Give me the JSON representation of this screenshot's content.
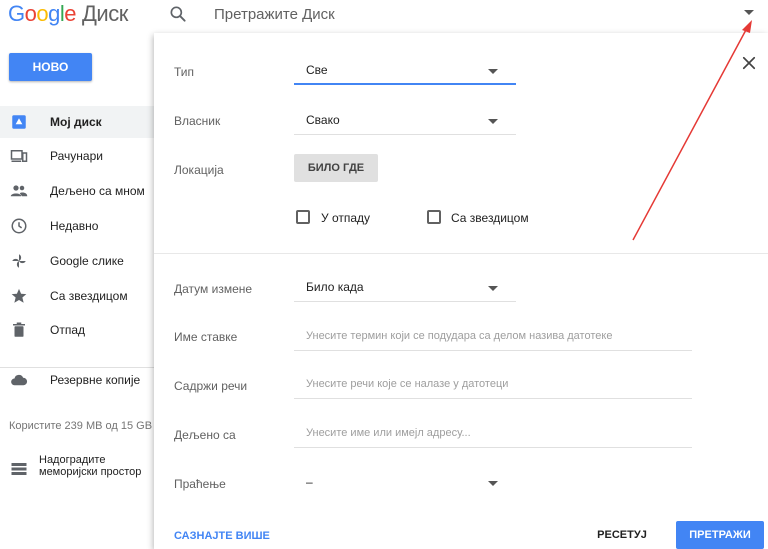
{
  "header": {
    "logo_letters": [
      "G",
      "o",
      "o",
      "g",
      "l",
      "e"
    ],
    "product": "Диск",
    "search_placeholder": "Претражите Диск"
  },
  "sidebar": {
    "new_label": "НОВО",
    "items": [
      {
        "label": "Мој диск",
        "icon": "my-drive-icon",
        "active": true
      },
      {
        "label": "Рачунари",
        "icon": "computers-icon"
      },
      {
        "label": "Дељено са мном",
        "icon": "shared-people-icon"
      },
      {
        "label": "Недавно",
        "icon": "clock-icon"
      },
      {
        "label": "Google слике",
        "icon": "pinwheel-icon"
      },
      {
        "label": "Са звездицом",
        "icon": "star-icon"
      },
      {
        "label": "Отпад",
        "icon": "trash-icon"
      },
      {
        "label": "Резервне копије",
        "icon": "cloud-icon"
      }
    ],
    "storage": "Користите 239 MB од 15 GB",
    "upgrade": "Надоградите меморијски простор"
  },
  "panel": {
    "type_label": "Тип",
    "type_value": "Све",
    "owner_label": "Власник",
    "owner_value": "Свако",
    "location_label": "Локација",
    "location_button": "БИЛО ГДЕ",
    "trash_checkbox": "У отпаду",
    "starred_checkbox": "Са звездицом",
    "modified_label": "Датум измене",
    "modified_value": "Било када",
    "item_name_label": "Име ставке",
    "item_name_placeholder": "Унесите термин који се подудара са делом назива датотеке",
    "contains_label": "Садржи речи",
    "contains_placeholder": "Унесите речи које се налазе у датотеци",
    "shared_label": "Дељено са",
    "shared_placeholder": "Унесите име или имејл адресу...",
    "followup_label": "Праћење",
    "followup_value": "–",
    "learn_more": "САЗНАЈТЕ ВИШЕ",
    "reset": "РЕСЕТУЈ",
    "search": "ПРЕТРАЖИ"
  },
  "colors": {
    "accent": "#4285f4",
    "annotation_arrow": "#e53935"
  }
}
